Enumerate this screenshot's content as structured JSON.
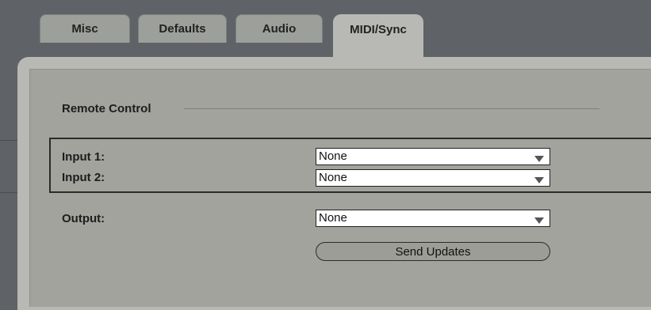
{
  "tabs": [
    {
      "label": "Misc"
    },
    {
      "label": "Defaults"
    },
    {
      "label": "Audio"
    },
    {
      "label": "MIDI/Sync",
      "active": true
    }
  ],
  "remote_control": {
    "title": "Remote Control",
    "input1": {
      "label": "Input 1:",
      "value": "None"
    },
    "input2": {
      "label": "Input 2:",
      "value": "None"
    },
    "output": {
      "label": "Output:",
      "value": "None"
    },
    "send_updates_label": "Send Updates"
  },
  "colors": {
    "background": "#5f6266",
    "tab": "#9d9f9b",
    "active_tab": "#b8b9b4",
    "panel": "#a2a39c",
    "select_bg": "#ffffff",
    "button_bg": "#9c9d96"
  },
  "icons": {
    "dropdown": "chevron-down-icon"
  }
}
